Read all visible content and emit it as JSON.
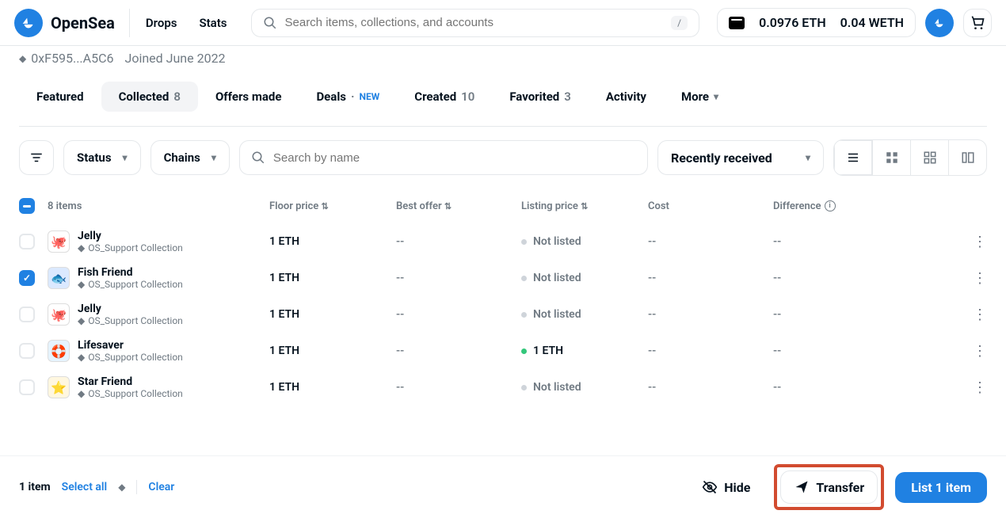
{
  "brand": {
    "name": "OpenSea"
  },
  "nav": {
    "drops": "Drops",
    "stats": "Stats"
  },
  "search": {
    "placeholder": "Search items, collections, and accounts",
    "shortcut": "/"
  },
  "wallet": {
    "eth": "0.0976 ETH",
    "weth": "0.04 WETH"
  },
  "profile": {
    "address": "0xF595...A5C6",
    "joined": "Joined June 2022"
  },
  "tabs": {
    "featured": "Featured",
    "collected": {
      "label": "Collected",
      "count": "8"
    },
    "offers": "Offers made",
    "deals": {
      "label": "Deals",
      "new": "NEW"
    },
    "created": {
      "label": "Created",
      "count": "10"
    },
    "favorited": {
      "label": "Favorited",
      "count": "3"
    },
    "activity": "Activity",
    "more": "More"
  },
  "filters": {
    "status": "Status",
    "chains": "Chains",
    "name_placeholder": "Search by name",
    "sort": "Recently received"
  },
  "table": {
    "items_count": "8 items",
    "head": {
      "floor": "Floor price",
      "best": "Best offer",
      "listing": "Listing price",
      "cost": "Cost",
      "diff": "Difference"
    },
    "rows": [
      {
        "name": "Jelly",
        "collection": "OS_Support Collection",
        "floor": "1 ETH",
        "best": "--",
        "listing": "Not listed",
        "listed": false,
        "cost": "--",
        "diff": "--",
        "checked": false,
        "thumb_bg": "#fff",
        "thumb_emoji": "🐙"
      },
      {
        "name": "Fish Friend",
        "collection": "OS_Support Collection",
        "floor": "1 ETH",
        "best": "--",
        "listing": "Not listed",
        "listed": false,
        "cost": "--",
        "diff": "--",
        "checked": true,
        "thumb_bg": "#dbe9ff",
        "thumb_emoji": "🐟"
      },
      {
        "name": "Jelly",
        "collection": "OS_Support Collection",
        "floor": "1 ETH",
        "best": "--",
        "listing": "Not listed",
        "listed": false,
        "cost": "--",
        "diff": "--",
        "checked": false,
        "thumb_bg": "#fff",
        "thumb_emoji": "🐙"
      },
      {
        "name": "Lifesaver",
        "collection": "OS_Support Collection",
        "floor": "1 ETH",
        "best": "--",
        "listing": "1 ETH",
        "listed": true,
        "cost": "--",
        "diff": "--",
        "checked": false,
        "thumb_bg": "#e6f4ff",
        "thumb_emoji": "🛟"
      },
      {
        "name": "Star Friend",
        "collection": "OS_Support Collection",
        "floor": "1 ETH",
        "best": "--",
        "listing": "Not listed",
        "listed": false,
        "cost": "--",
        "diff": "--",
        "checked": false,
        "thumb_bg": "#fff7e0",
        "thumb_emoji": "⭐"
      }
    ]
  },
  "footer": {
    "selected": "1 item",
    "select_all": "Select all",
    "clear": "Clear",
    "hide": "Hide",
    "transfer": "Transfer",
    "list": "List 1 item"
  }
}
